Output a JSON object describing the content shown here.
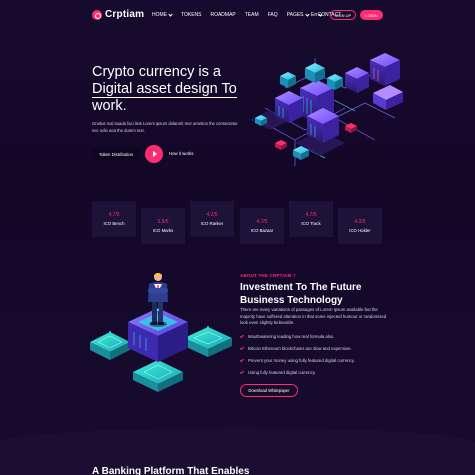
{
  "header": {
    "logo_text": "Crptiam",
    "nav": [
      {
        "label": "HOME",
        "dropdown": true
      },
      {
        "label": "TOKENS",
        "dropdown": false
      },
      {
        "label": "ROADMAP",
        "dropdown": false
      },
      {
        "label": "TEAM",
        "dropdown": false
      },
      {
        "label": "FAQ",
        "dropdown": false
      },
      {
        "label": "PAGES",
        "dropdown": true
      },
      {
        "label": "CONTACT",
        "dropdown": false
      }
    ],
    "language": "En",
    "signup_label": "SIGN UP",
    "login_label": "LOGIN"
  },
  "hero": {
    "title_line1": "Crypto currency is a",
    "title_line2": "Digital asset design To",
    "title_line3": "work.",
    "description": "Gruitus mal suada faci lisis Lorem ipsum dolarorit mor ametion the consectetur nec odio aea the dumm text.",
    "token_button": "Token Distribution",
    "how_label": "How it works"
  },
  "stats": [
    {
      "value": "4.7/5",
      "label": "ICO Bench"
    },
    {
      "value": "5.5/5",
      "label": "ICO Marks"
    },
    {
      "value": "4.2/5",
      "label": "ICO Ranker"
    },
    {
      "value": "4.7/5",
      "label": "ICO Bazaar"
    },
    {
      "value": "4.7/5",
      "label": "ICO Track"
    },
    {
      "value": "4.2/5",
      "label": "ICO Holder"
    }
  ],
  "about": {
    "kicker": "ABOUT THE CRPTIAM ?",
    "title": "Investment To The Future Business Technology",
    "description": "There are many variations of passages of Lorem Ipsum available but the majority have suffered alteration in that some injected humour or randomised look even slightly believable.",
    "features": [
      "Mouthwatering leading how real formula also.",
      "Bitcoin Ethereum blockchains are slow and expensive.",
      "Prevent your money using fully featured digital currency.",
      "Using fully featured digital currency."
    ],
    "button": "Download Whitepaper"
  },
  "bottom": {
    "heading": "A Banking Platform That Enables"
  },
  "colors": {
    "accent": "#ff2d6f",
    "background": "#150a2b",
    "card": "#1d1238",
    "cyan": "#2fd8e6",
    "violet": "#7a5cff"
  }
}
